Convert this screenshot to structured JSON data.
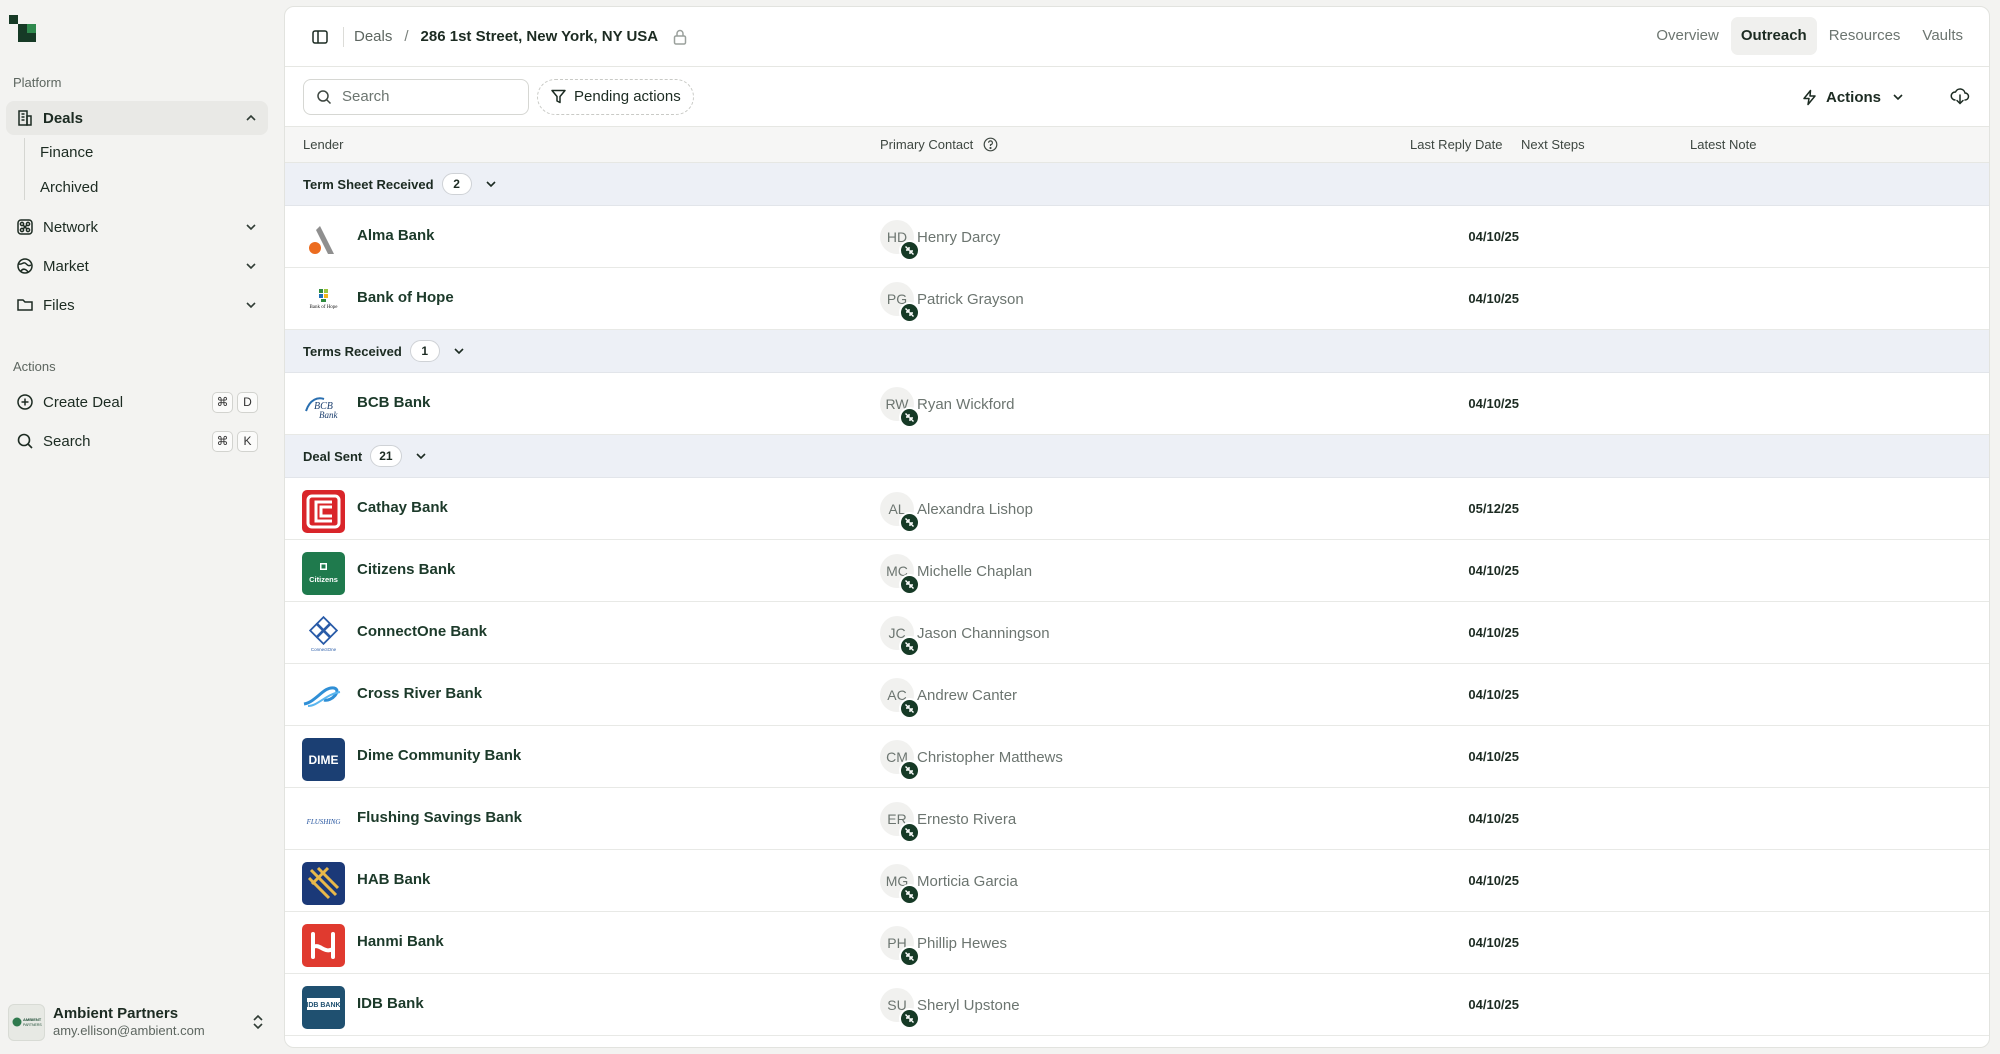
{
  "sidebar": {
    "platform_label": "Platform",
    "actions_label": "Actions",
    "nav": [
      {
        "label": "Deals",
        "icon": "building-icon",
        "active": true
      },
      {
        "label": "Network",
        "icon": "network-icon"
      },
      {
        "label": "Market",
        "icon": "globe-icon"
      },
      {
        "label": "Files",
        "icon": "folder-icon"
      }
    ],
    "deals_sub": [
      {
        "label": "Finance"
      },
      {
        "label": "Archived"
      }
    ],
    "actions": [
      {
        "label": "Create Deal",
        "shortcut": [
          "⌘",
          "D"
        ]
      },
      {
        "label": "Search",
        "shortcut": [
          "⌘",
          "K"
        ]
      }
    ],
    "user": {
      "name": "Ambient Partners",
      "email": "amy.ellison@ambient.com",
      "avatar_text": "AMBIENT PARTNERS"
    }
  },
  "header": {
    "breadcrumb_root": "Deals",
    "breadcrumb_sep": "/",
    "breadcrumb_current": "286 1st Street, New York, NY USA",
    "tabs": [
      {
        "label": "Overview"
      },
      {
        "label": "Outreach",
        "active": true
      },
      {
        "label": "Resources"
      },
      {
        "label": "Vaults"
      }
    ]
  },
  "toolbar": {
    "search_placeholder": "Search",
    "pending_label": "Pending actions",
    "actions_label": "Actions"
  },
  "table": {
    "columns": {
      "lender": "Lender",
      "primary_contact": "Primary Contact",
      "last_reply": "Last Reply Date",
      "next_steps": "Next Steps",
      "latest_note": "Latest Note"
    },
    "groups": [
      {
        "label": "Term Sheet Received",
        "count": "2",
        "rows": [
          {
            "bank": "Alma Bank",
            "initials": "HD",
            "contact": "Henry Darcy",
            "date": "04/10/25",
            "logo": "alma"
          },
          {
            "bank": "Bank of Hope",
            "initials": "PG",
            "contact": "Patrick Grayson",
            "date": "04/10/25",
            "logo": "hope",
            "logo_text": "Bank of Hope"
          }
        ]
      },
      {
        "label": "Terms Received",
        "count": "1",
        "rows": [
          {
            "bank": "BCB Bank",
            "initials": "RW",
            "contact": "Ryan Wickford",
            "date": "04/10/25",
            "logo": "bcb",
            "logo_text": "BCB Bank"
          }
        ]
      },
      {
        "label": "Deal Sent",
        "count": "21",
        "rows": [
          {
            "bank": "Cathay Bank",
            "initials": "AL",
            "contact": "Alexandra Lishop",
            "date": "05/12/25",
            "logo": "cathay"
          },
          {
            "bank": "Citizens Bank",
            "initials": "MC",
            "contact": "Michelle Chaplan",
            "date": "04/10/25",
            "logo": "citizens",
            "logo_text": "Citizens"
          },
          {
            "bank": "ConnectOne Bank",
            "initials": "JC",
            "contact": "Jason Channingson",
            "date": "04/10/25",
            "logo": "connectone"
          },
          {
            "bank": "Cross River Bank",
            "initials": "AC",
            "contact": "Andrew Canter",
            "date": "04/10/25",
            "logo": "crossriver"
          },
          {
            "bank": "Dime Community Bank",
            "initials": "CM",
            "contact": "Christopher Matthews",
            "date": "04/10/25",
            "logo": "dime",
            "logo_text": "DIME"
          },
          {
            "bank": "Flushing Savings Bank",
            "initials": "ER",
            "contact": "Ernesto Rivera",
            "date": "04/10/25",
            "logo": "flushing",
            "logo_text": "FLUSHING"
          },
          {
            "bank": "HAB Bank",
            "initials": "MG",
            "contact": "Morticia Garcia",
            "date": "04/10/25",
            "logo": "hab"
          },
          {
            "bank": "Hanmi Bank",
            "initials": "PH",
            "contact": "Phillip Hewes",
            "date": "04/10/25",
            "logo": "hanmi"
          },
          {
            "bank": "IDB Bank",
            "initials": "SU",
            "contact": "Sheryl Upstone",
            "date": "04/10/25",
            "logo": "idb",
            "logo_text": "IDB BANK"
          }
        ]
      }
    ]
  },
  "colors": {
    "brand_dark": "#163a26",
    "group_bg": "#edf0f6"
  }
}
